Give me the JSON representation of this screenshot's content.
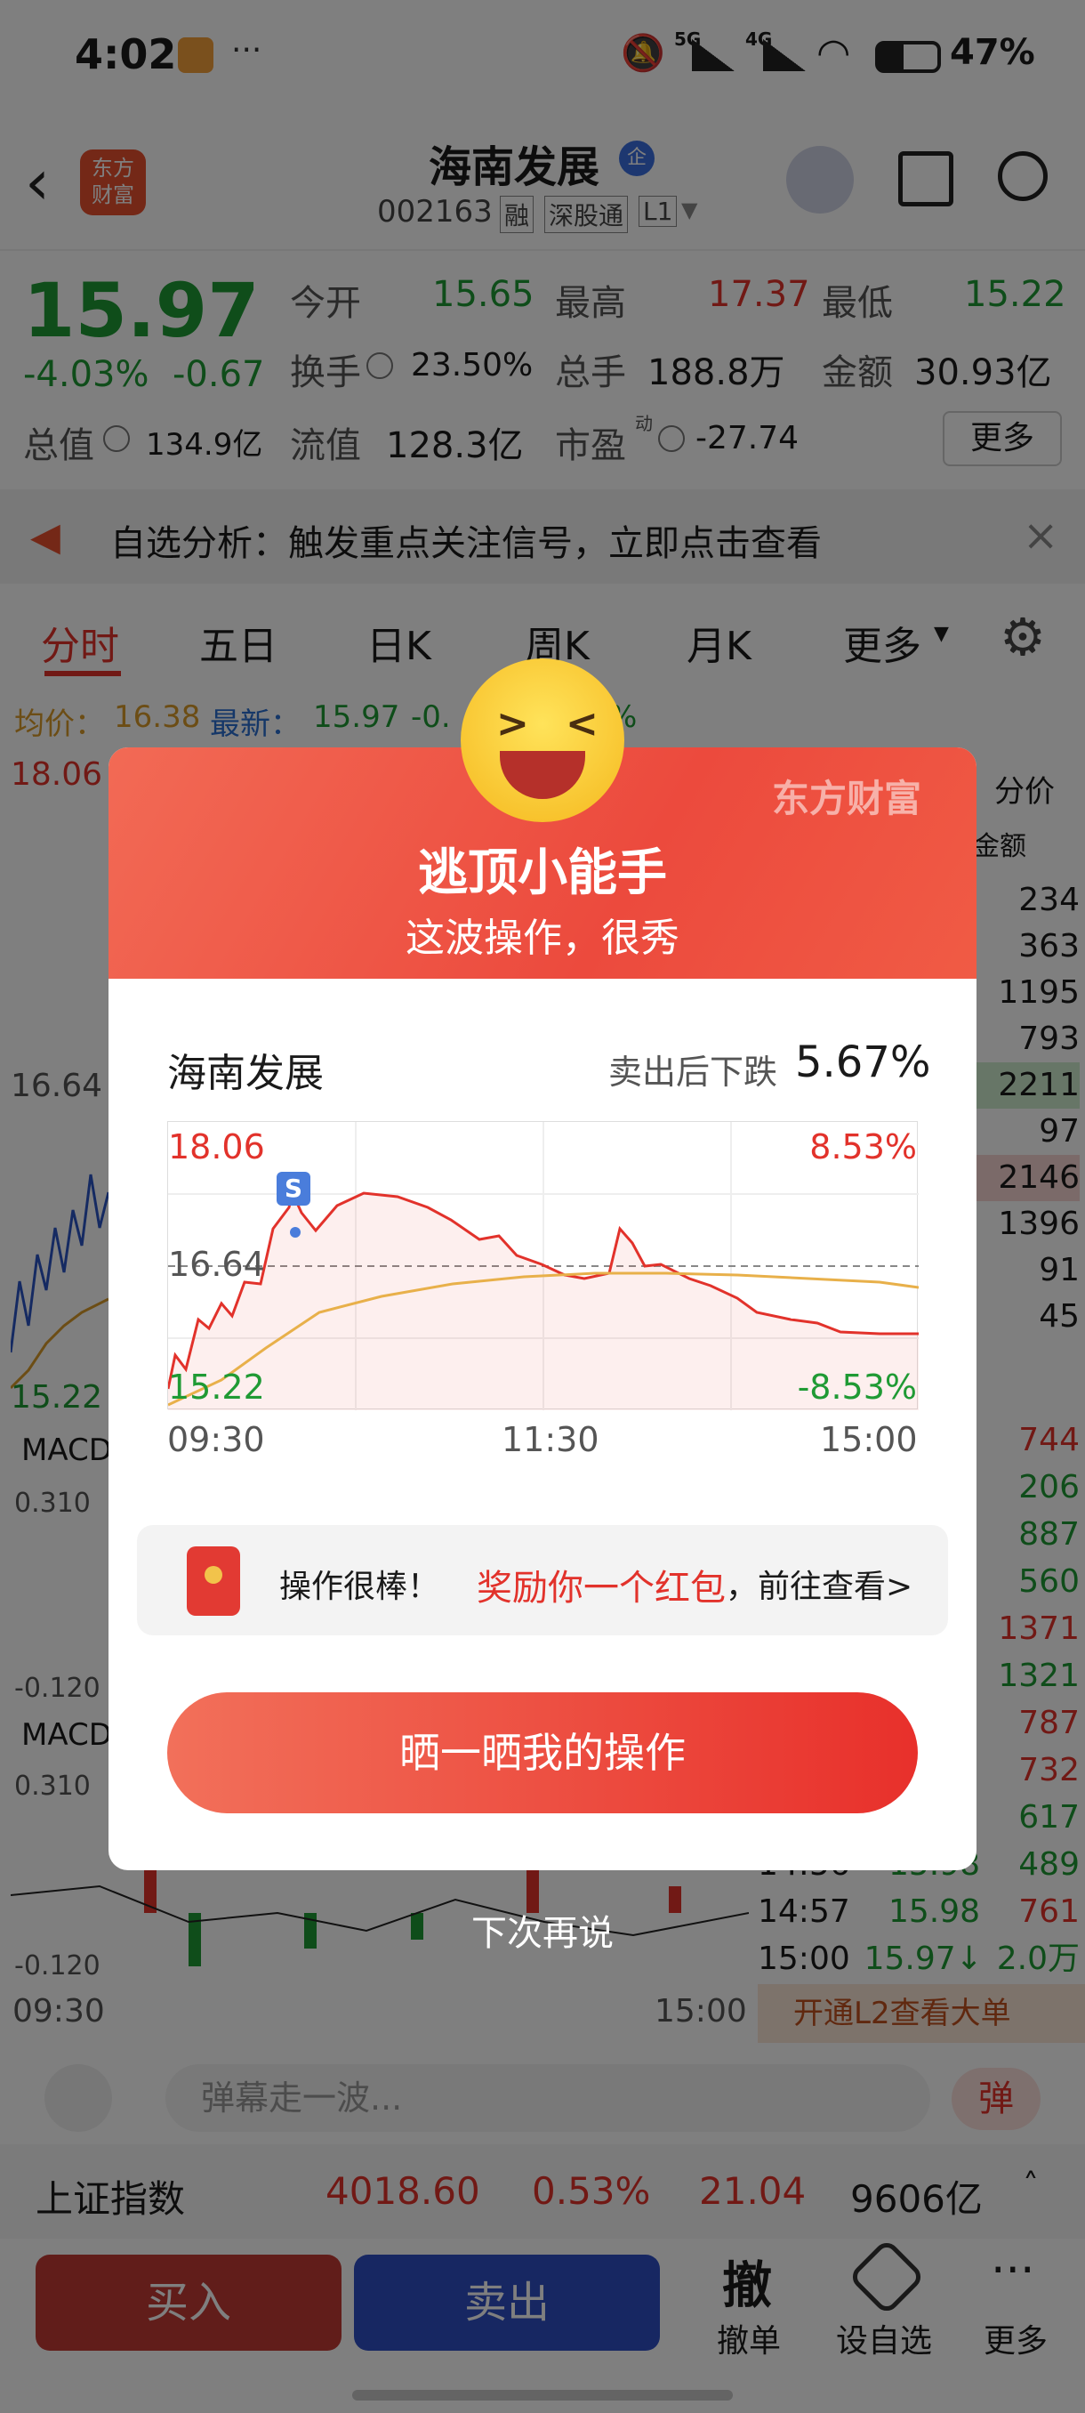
{
  "status_bar": {
    "time": "4:02",
    "battery": "47%",
    "signal_labels": [
      "5G",
      "4G"
    ],
    "icons": [
      "app-notification-icon",
      "more-dots-icon",
      "mute-icon",
      "signal-icon",
      "wifi-icon",
      "battery-icon"
    ]
  },
  "header": {
    "brand_logo_text": "东方\n财富",
    "stock_name": "海南发展",
    "badge": "企",
    "stock_code": "002163",
    "tags": [
      "融",
      "深股通",
      "L1"
    ],
    "icons": [
      "back-icon",
      "robot-avatar-icon",
      "share-icon",
      "search-icon"
    ]
  },
  "quote": {
    "price": "15.97",
    "change_pct": "-4.03%",
    "change": "-0.67",
    "open_label": "今开",
    "open": "15.65",
    "high_label": "最高",
    "high": "17.37",
    "low_label": "最低",
    "low": "15.22",
    "turnover_label": "换手",
    "turnover": "23.50%",
    "volume_label": "总手",
    "volume": "188.8万",
    "amount_label": "金额",
    "amount": "30.93亿",
    "mktcap_label": "总值",
    "mktcap": "134.9亿",
    "float_label": "流值",
    "float_cap": "128.3亿",
    "pe_label": "市盈",
    "pe_sup": "动",
    "pe": "-27.74",
    "more_button": "更多"
  },
  "alert": {
    "text": "自选分析：触发重点关注信号，立即点击查看"
  },
  "tabs": [
    "分时",
    "五日",
    "日K",
    "周K",
    "月K",
    "更多"
  ],
  "chart_info": {
    "avg_label": "均价：",
    "avg_value": "16.38",
    "latest_label": "最新：",
    "latest_value": "15.97",
    "partial": "-0.",
    "partial_pct": "%"
  },
  "bg_chart": {
    "price_high": "18.06",
    "price_mid": "16.64",
    "price_low": "15.22",
    "macd_label": "MACD",
    "macd_top": "0.310",
    "macd_bottom": "-0.120",
    "time_start": "09:30",
    "time_end": "15:00",
    "orderbook_header": "分价",
    "orderbook_sub": "金额",
    "orderbook_values": [
      "234",
      "363",
      "1195",
      "793",
      "2211",
      "97",
      "2146",
      "1396",
      "91",
      "45"
    ],
    "ticks": [
      [
        "",
        "",
        "744"
      ],
      [
        "",
        "",
        "206"
      ],
      [
        "",
        "",
        "887"
      ],
      [
        "",
        "",
        "560"
      ],
      [
        "",
        "",
        "1371"
      ],
      [
        "",
        "",
        "1321"
      ],
      [
        "",
        "",
        "787"
      ],
      [
        "",
        "",
        "732"
      ],
      [
        "",
        "",
        "617"
      ],
      [
        "14:56",
        "15.98",
        "489"
      ],
      [
        "14:57",
        "15.98",
        "761"
      ],
      [
        "15:00",
        "15.97↓",
        "2.0万"
      ]
    ],
    "l2_banner": "开通L2查看大单"
  },
  "danmu": {
    "placeholder": "弹幕走一波...",
    "button": "弹"
  },
  "index_bar": {
    "name": "上证指数",
    "value": "4018.60",
    "pct": "0.53%",
    "change": "21.04",
    "amount": "9606亿"
  },
  "trade_bar": {
    "buy": "买入",
    "sell": "卖出",
    "cancel_char": "撤",
    "cancel": "撤单",
    "watch": "设自选",
    "more": "更多"
  },
  "modal": {
    "brand": "东方财富",
    "title": "逃顶小能手",
    "subtitle": "这波操作，很秀",
    "stock_name": "海南发展",
    "drop_label": "卖出后下跌",
    "drop_value": "5.67%",
    "chart_top_price": "18.06",
    "chart_top_pct": "8.53%",
    "chart_mid": "16.64",
    "chart_bottom_price": "15.22",
    "chart_bottom_pct": "-8.53%",
    "time_start": "09:30",
    "time_mid": "11:30",
    "time_end": "15:00",
    "sell_marker": "S",
    "reward_prefix": "操作很棒！",
    "reward_highlight": "奖励你一个红包",
    "reward_suffix": "，前往查看>",
    "cta": "晒一晒我的操作",
    "dismiss": "下次再说"
  },
  "colors": {
    "up": "#e2322b",
    "down": "#1f9a34",
    "accent": "#e8302b",
    "buy": "#b52f2b",
    "sell": "#2f4fc4"
  }
}
